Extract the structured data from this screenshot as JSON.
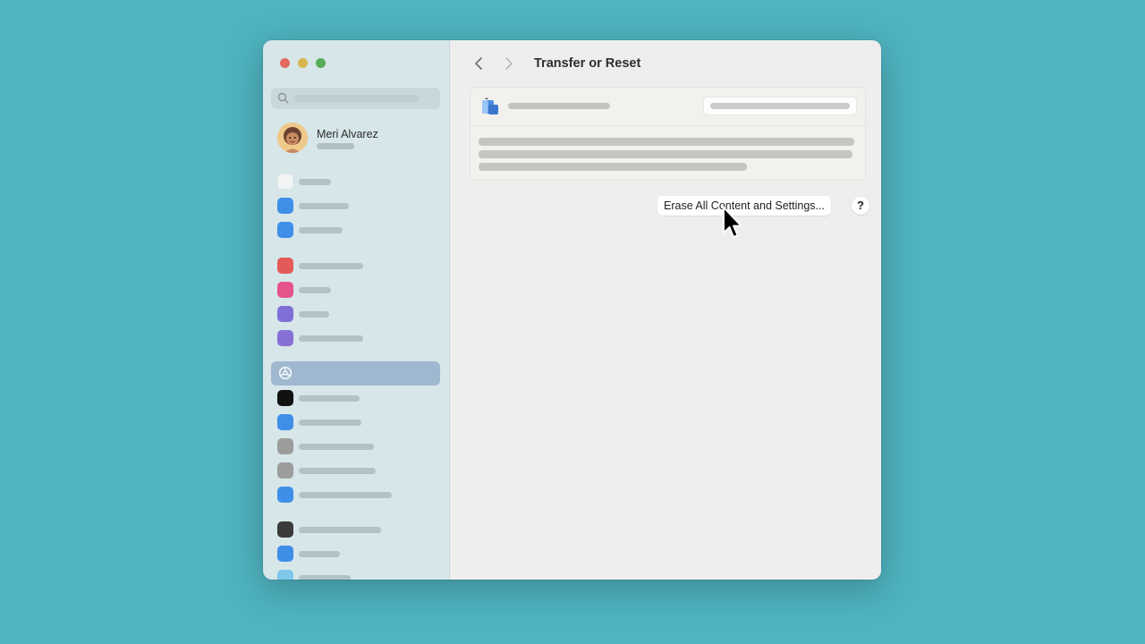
{
  "window": {
    "traffic_lights": {
      "close": "#e36a5e",
      "minimize": "#d9b64f",
      "zoom": "#58ad5a"
    }
  },
  "sidebar": {
    "search_icon": "search-icon",
    "user": {
      "name": "Meri Alvarez"
    },
    "items": [
      {
        "icon_color": "#f2f4f5"
      },
      {
        "icon_color": "#3f8ee8"
      },
      {
        "icon_color": "#3f8ee8"
      },
      {
        "icon_color": "#e35a58"
      },
      {
        "icon_color": "#e6528a"
      },
      {
        "icon_color": "#7f6fd6"
      },
      {
        "icon_color": "#8670d6"
      },
      {
        "icon_color": "#9fb8cf",
        "selected": true,
        "icon": "general-icon"
      },
      {
        "icon_color": "#111111"
      },
      {
        "icon_color": "#3f8ee8"
      },
      {
        "icon_color": "#9c9c9c"
      },
      {
        "icon_color": "#9c9c9c"
      },
      {
        "icon_color": "#3f8ee8"
      },
      {
        "icon_color": "#3a3a3a"
      },
      {
        "icon_color": "#3f8ee8"
      },
      {
        "icon_color": "#7ec8ea"
      }
    ]
  },
  "main": {
    "title": "Transfer or Reset",
    "erase_button_label": "Erase All Content and Settings...",
    "help_label": "?"
  }
}
